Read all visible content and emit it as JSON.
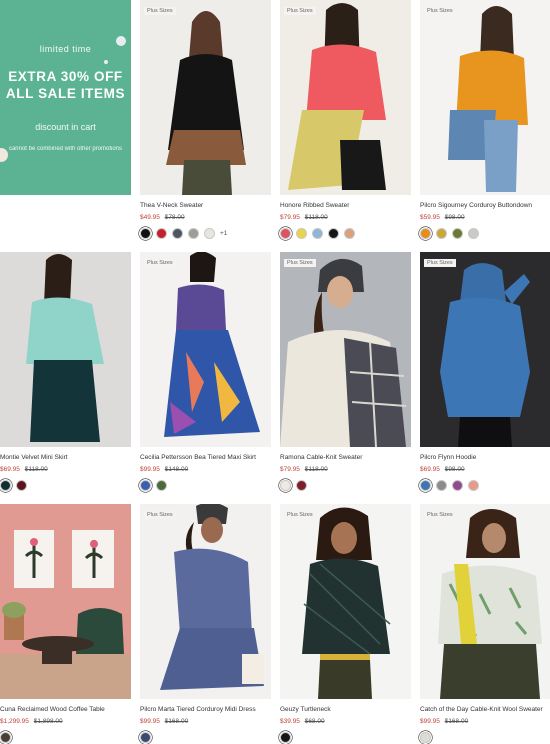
{
  "promo": {
    "line1": "limited time",
    "line2": "EXTRA 30% OFF",
    "line3": "ALL SALE ITEMS",
    "line4": "discount in cart",
    "line5": "cannot be combined with other promotions",
    "color": "#5cb394"
  },
  "badge_label": "Plus Sizes",
  "products": [
    {
      "name": "Thea V-Neck Sweater",
      "sale_price": "$49.95",
      "orig_price": "$78.00",
      "badge": true,
      "swatches": [
        "#111111",
        "#c3212c",
        "#4d5660",
        "#9a9e97",
        "#e7e5df"
      ],
      "more": "+1"
    },
    {
      "name": "Honore Ribbed Sweater",
      "sale_price": "$79.95",
      "orig_price": "$118.00",
      "badge": true,
      "swatches": [
        "#e0535e",
        "#e7d64c",
        "#8fb5d8",
        "#161616",
        "#d9a27e"
      ],
      "more": ""
    },
    {
      "name": "Pilcro Sigourney Corduroy Buttondown",
      "sale_price": "$59.95",
      "orig_price": "$98.00",
      "badge": true,
      "swatches": [
        "#e58e1c",
        "#c8a83a",
        "#6a7a36",
        "#c9ccc6"
      ],
      "more": ""
    },
    {
      "name": "Montie Velvet Mini Skirt",
      "sale_price": "$69.95",
      "orig_price": "$118.00",
      "badge": false,
      "swatches": [
        "#0f2f32",
        "#5c1420"
      ],
      "more": ""
    },
    {
      "name": "Cecilia Pettersson Bea Tiered Maxi Skirt",
      "sale_price": "$99.95",
      "orig_price": "$148.00",
      "badge": true,
      "swatches": [
        "#3b5fb0",
        "#4a6a3a"
      ],
      "more": ""
    },
    {
      "name": "Ramona Cable-Knit Sweater",
      "sale_price": "$79.95",
      "orig_price": "$118.00",
      "badge": true,
      "swatches": [
        "#eeeae3",
        "#7d1f2a"
      ],
      "more": ""
    },
    {
      "name": "Pilcro Flynn Hoodie",
      "sale_price": "$69.95",
      "orig_price": "$98.00",
      "badge": true,
      "swatches": [
        "#3f73b3",
        "#8a8c8e",
        "#934a8c",
        "#e89a87"
      ],
      "more": ""
    },
    {
      "name": "Cuna Reclaimed Wood Coffee Table",
      "sale_price": "$1,299.95",
      "orig_price": "$1,898.00",
      "badge": false,
      "swatches": [
        "#4a3d33"
      ],
      "more": ""
    },
    {
      "name": "Pilcro Marta Tiered Corduroy Midi Dress",
      "sale_price": "$99.95",
      "orig_price": "$168.00",
      "badge": true,
      "swatches": [
        "#3c4a72"
      ],
      "more": ""
    },
    {
      "name": "Geuzy Turtleneck",
      "sale_price": "$39.95",
      "orig_price": "$68.00",
      "badge": true,
      "swatches": [
        "#161616"
      ],
      "more": ""
    },
    {
      "name": "Catch of the Day Cable-Knit Wool Sweater",
      "sale_price": "$99.95",
      "orig_price": "$168.00",
      "badge": true,
      "swatches": [
        "#d9ddd5"
      ],
      "more": ""
    }
  ]
}
